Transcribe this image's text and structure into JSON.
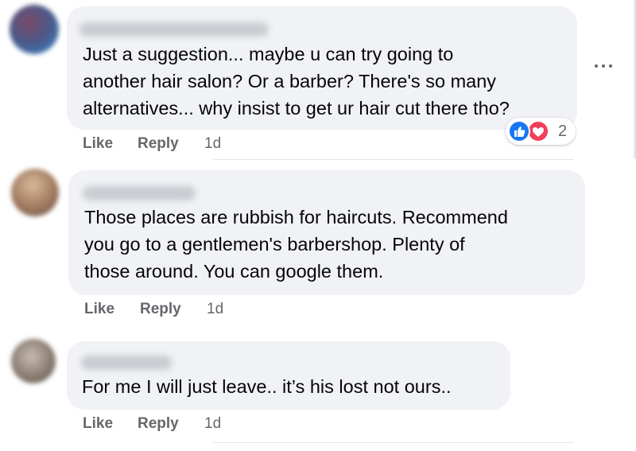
{
  "comments": [
    {
      "author": "Muhammad Saddam",
      "text_lines": [
        "Just a suggestion... maybe u can try going to",
        "another hair salon? Or a barber? There's so many",
        "alternatives... why insist to get ur hair cut there tho?"
      ],
      "like_label": "Like",
      "reply_label": "Reply",
      "time": "1d",
      "reactions": {
        "icons": [
          "like-icon",
          "love-icon"
        ],
        "count": "2"
      }
    },
    {
      "author": "Tadly Huat",
      "text_lines": [
        "Those places are rubbish for haircuts. Recommend",
        "you go to a gentlemen's barbershop. Plenty of",
        "those around. You can google them."
      ],
      "like_label": "Like",
      "reply_label": "Reply",
      "time": "1d"
    },
    {
      "author": "Dean Seet",
      "text_lines": [
        "For me I will just leave.. it’s his lost not ours.."
      ],
      "like_label": "Like",
      "reply_label": "Reply",
      "time": "1d"
    }
  ],
  "more_menu": {
    "icon": "more-horizontal-icon"
  },
  "colors": {
    "bubble": "#f0f2f5",
    "meta_text": "#65676b",
    "like_blue": "#1877f2",
    "love_red": "#f33e58"
  }
}
